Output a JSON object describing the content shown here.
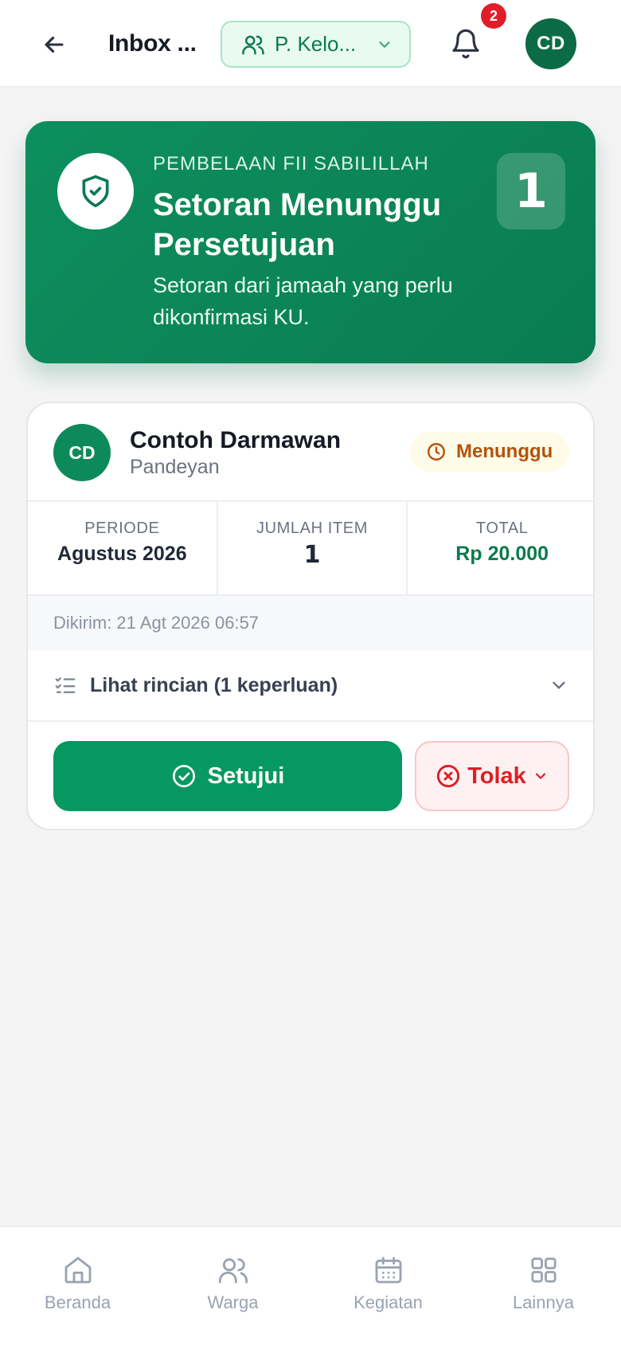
{
  "header": {
    "title": "Inbox ...",
    "group_selector": "P. Kelo...",
    "notification_count": "2",
    "user_initials": "CD"
  },
  "hero": {
    "kicker": "PEMBELAAN FII SABILILLAH",
    "title": "Setoran Menunggu Persetujuan",
    "description": "Setoran dari jamaah yang perlu dikonfirmasi KU.",
    "count": "1"
  },
  "submission": {
    "initials": "CD",
    "name": "Contoh Darmawan",
    "area": "Pandeyan",
    "status": "Menunggu",
    "period_label": "PERIODE",
    "period_value": "Agustus 2026",
    "items_label": "JUMLAH ITEM",
    "items_value": "1",
    "total_label": "TOTAL",
    "total_value": "Rp 20.000",
    "sent_at": "Dikirim: 21 Agt 2026 06:57",
    "details_label": "Lihat rincian (1 keperluan)",
    "approve_label": "Setujui",
    "reject_label": "Tolak"
  },
  "nav": [
    {
      "label": "Beranda",
      "icon": "home-icon"
    },
    {
      "label": "Warga",
      "icon": "users-icon"
    },
    {
      "label": "Kegiatan",
      "icon": "calendar-icon"
    },
    {
      "label": "Lainnya",
      "icon": "grid-icon"
    }
  ],
  "colors": {
    "brand_green": "#0b7a52",
    "status_pending": "#b45309",
    "reject_red": "#dc1f26"
  }
}
